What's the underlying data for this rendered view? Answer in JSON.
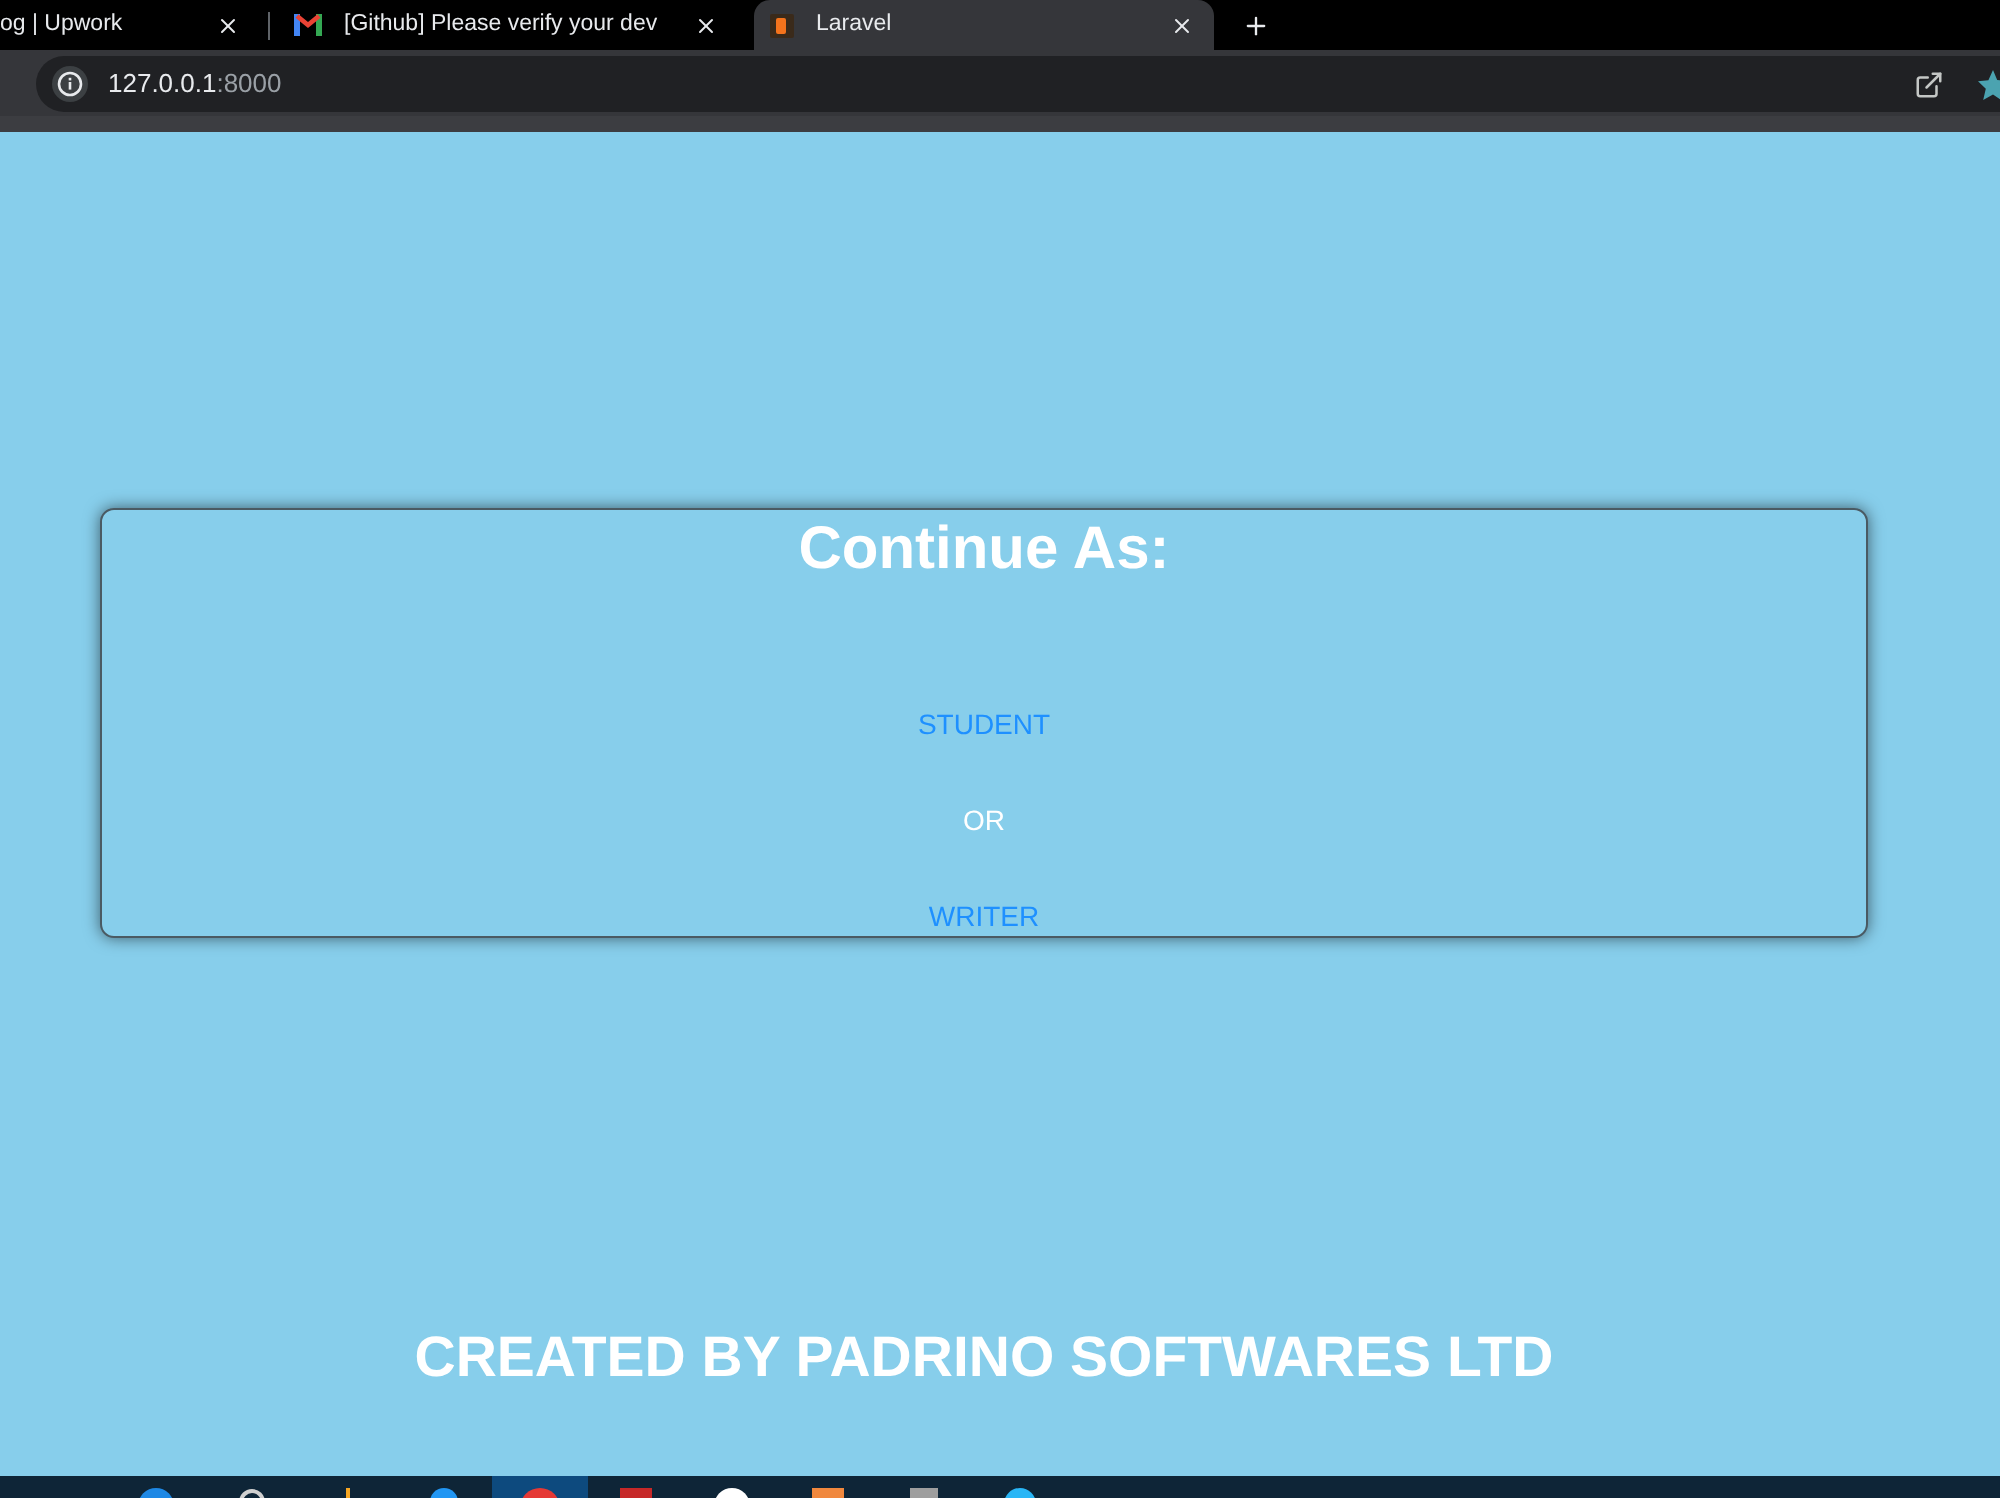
{
  "browser": {
    "tabs": [
      {
        "title": "og | Upwork",
        "kind": "none",
        "selected": false
      },
      {
        "title": "[Github] Please verify your dev",
        "kind": "mail",
        "selected": false
      },
      {
        "title": "Laravel",
        "kind": "logo",
        "selected": true
      }
    ],
    "address": {
      "host": "127.0.0.1",
      "port": ":8000"
    }
  },
  "card": {
    "title": "Continue As:",
    "options": [
      {
        "label": "STUDENT",
        "kind": "link"
      },
      {
        "label": "OR",
        "kind": "text"
      },
      {
        "label": "WRITER",
        "kind": "link"
      }
    ]
  },
  "footer": {
    "credit": "CREATED BY PADRINO SOFTWARES LTD"
  },
  "taskbar": {
    "apps": [
      {
        "selected": false
      },
      {
        "selected": false
      },
      {
        "selected": false
      },
      {
        "selected": false
      },
      {
        "selected": true
      },
      {
        "selected": false
      },
      {
        "selected": false
      },
      {
        "selected": false
      },
      {
        "selected": false
      },
      {
        "selected": false
      }
    ]
  }
}
